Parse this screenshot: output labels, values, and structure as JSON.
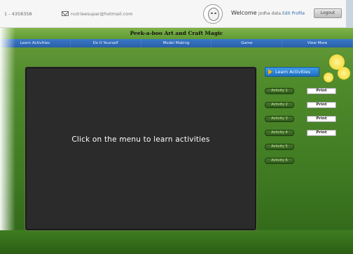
{
  "topbar": {
    "phone": "1 - 4358358",
    "email": "nutrieesupar@hotmail.com",
    "welcome": "Welcome",
    "username": "jodha data",
    "edit_profile": "Edit Profile",
    "logout_label": "Logout"
  },
  "site_title": "Peek-a-boo Art and Craft Magic",
  "nav": [
    {
      "label": "Learn Activities"
    },
    {
      "label": "Do It Yourself"
    },
    {
      "label": "Model Making"
    },
    {
      "label": "Game"
    },
    {
      "label": "View More"
    }
  ],
  "screen": {
    "message": "Click on the menu to learn activities"
  },
  "panel": {
    "learn_button": "Learn Activities",
    "activities": [
      {
        "label": "Activity 1",
        "print": "Print"
      },
      {
        "label": "Activity 2",
        "print": "Print"
      },
      {
        "label": "Activity 3",
        "print": "Print"
      },
      {
        "label": "Activity 4",
        "print": "Print"
      },
      {
        "label": "Activity 5",
        "print": ""
      },
      {
        "label": "Activity 6",
        "print": ""
      }
    ]
  },
  "colors": {
    "nav_blue": "#2a5ea8",
    "grass_green": "#4f8a2b",
    "screen_dark": "#2b2b2b",
    "accent_blue": "#1f6fc0"
  }
}
